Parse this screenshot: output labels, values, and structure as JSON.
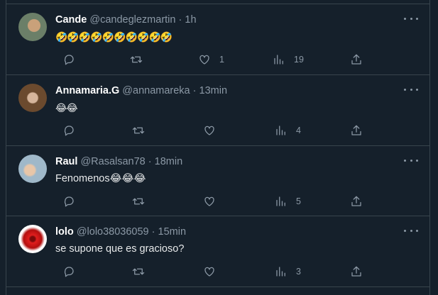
{
  "colors": {
    "background": "#15202b",
    "border": "#38444d",
    "muted": "#8b98a5",
    "text": "#e7e9ea"
  },
  "tweets": [
    {
      "name": "Cande",
      "handle": "@candeglezmartin",
      "dot": "·",
      "time": "1h",
      "text": "🤣🤣🤣🤣🤣🤣🤣🤣🤣🤣",
      "replies": "",
      "retweets": "",
      "likes": "1",
      "views": "19"
    },
    {
      "name": "Annamaria.G",
      "handle": "@annamareka",
      "dot": "·",
      "time": "13min",
      "text": "😂😂",
      "replies": "",
      "retweets": "",
      "likes": "",
      "views": "4"
    },
    {
      "name": "Raul",
      "handle": "@Rasalsan78",
      "dot": "·",
      "time": "18min",
      "text": "Fenomenos😂😂😂",
      "replies": "",
      "retweets": "",
      "likes": "",
      "views": "5"
    },
    {
      "name": "lolo",
      "handle": "@lolo38036059",
      "dot": "·",
      "time": "15min",
      "text": "se supone que es gracioso?",
      "replies": "",
      "retweets": "",
      "likes": "",
      "views": "3"
    }
  ],
  "icons": [
    "reply-icon",
    "retweet-icon",
    "like-icon",
    "views-icon",
    "share-icon",
    "more-icon"
  ]
}
